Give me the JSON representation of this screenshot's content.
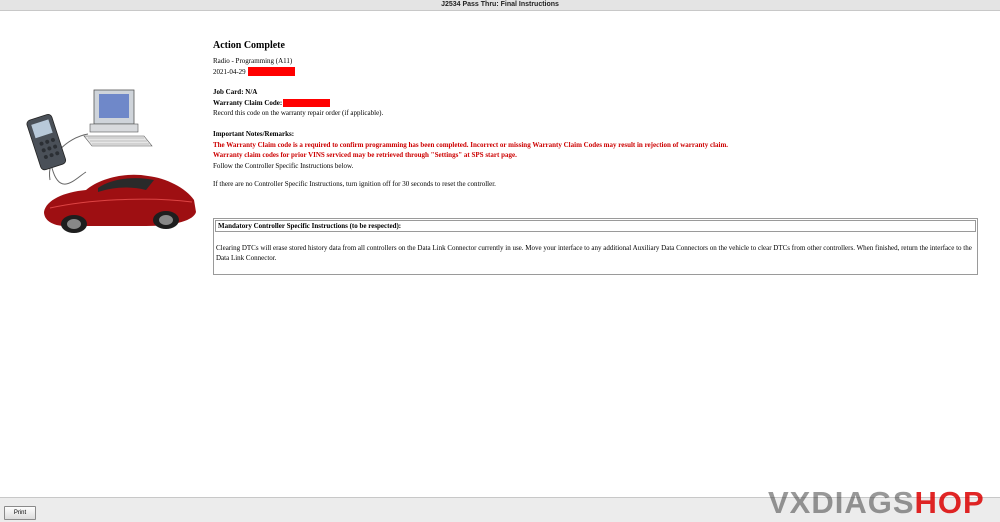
{
  "window": {
    "title": "J2534 Pass Thru:  Final Instructions"
  },
  "main": {
    "heading": "Action Complete",
    "subtitle": "Radio - Programming (A11)",
    "date": "2021-04-29",
    "job_card": "Job Card: N/A",
    "warranty_label": "Warranty Claim Code:",
    "record_note": "Record this code on the warranty repair order (if applicable).",
    "notes_heading": "Important Notes/Remarks:",
    "warning_1": "The Warranty Claim code is a required to confirm programming has been completed. Incorrect or missing Warranty Claim Codes may result in rejection of warranty claim.",
    "warning_2": "Warranty claim codes for prior VINS serviced may be retrieved through \"Settings\" at SPS start page.",
    "follow_note": "Follow the Controller Specific Instructions below.",
    "ignition_note": "If there are no Controller Specific Instructions, turn ignition off for 30 seconds to reset the controller."
  },
  "instructions_box": {
    "header": "Mandatory Controller Specific Instructions (to be respected):",
    "body": "Clearing DTCs will erase stored history data from all controllers on the Data Link Connector currently in use. Move your interface to any additional Auxiliary Data Connectors on the vehicle to clear DTCs from other controllers. When finished, return the interface to the Data Link Connector."
  },
  "footer": {
    "print_label": "Print"
  },
  "watermark": {
    "text_gray": "VXDIAGS",
    "text_red": "HOP"
  },
  "colors": {
    "redaction": "#ff0000",
    "warning_text": "#cc0000",
    "car": "#9e0f12"
  },
  "icons": {
    "illustration": "car-scan-tool-computer-illustration"
  }
}
